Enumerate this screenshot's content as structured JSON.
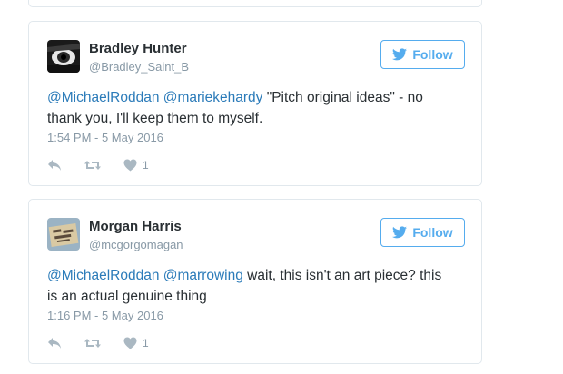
{
  "tweets": [
    {
      "name": "Bradley Hunter",
      "handle": "@Bradley_Saint_B",
      "follow_label": "Follow",
      "mention1": "@MichaelRoddan",
      "mention2": "@mariekehardy",
      "text_rest_line1": " \"Pitch original ideas\" - no",
      "text_line2": "thank you, I'll keep them to myself.",
      "time": "1:54 PM - 5 May 2016",
      "likes": "1"
    },
    {
      "name": "Morgan Harris",
      "handle": "@mcgorgomagan",
      "follow_label": "Follow",
      "mention1": "@MichaelRoddan",
      "mention2": "@marrowing",
      "text_rest_line1": " wait, this isn't an art piece? this",
      "text_line2": "is an actual genuine thing",
      "time": "1:16 PM - 5 May 2016",
      "likes": "1"
    }
  ],
  "colors": {
    "link": "#2b7bb9",
    "accent": "#55acee",
    "muted": "#8899a6",
    "icon": "#aab8c2",
    "border": "#e1e8ed"
  },
  "icons": [
    "twitter-bird-icon",
    "reply-icon",
    "retweet-icon",
    "heart-icon"
  ]
}
